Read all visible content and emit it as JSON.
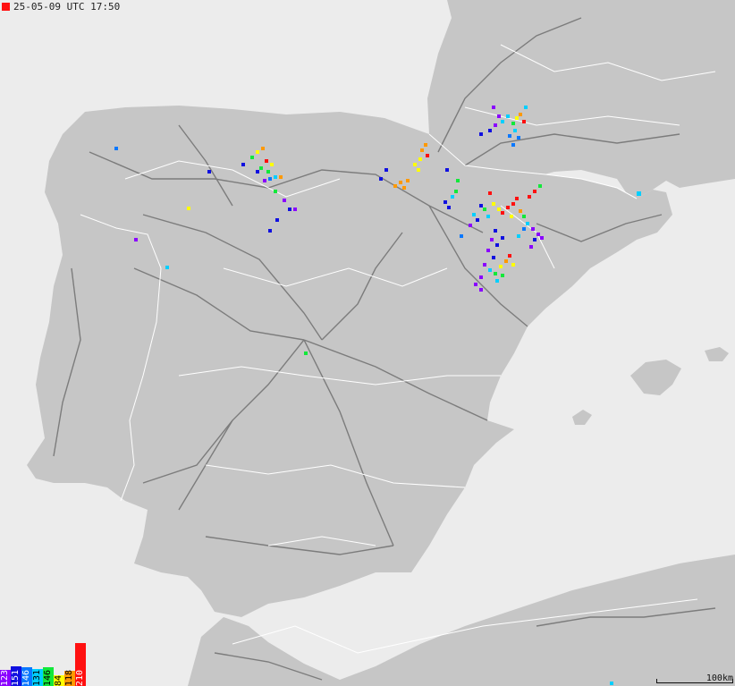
{
  "timestamp": {
    "text": "25-05-09 UTC 17:50",
    "marker_color": "#ff1010"
  },
  "scale": {
    "label": "100km"
  },
  "legend": [
    {
      "label": "123",
      "color": "#8a00ff",
      "level": 0.37
    },
    {
      "label": "151",
      "color": "#1010e0",
      "level": 0.45
    },
    {
      "label": "146",
      "color": "#0a78ff",
      "level": 0.44
    },
    {
      "label": "131",
      "color": "#00cfff",
      "level": 0.39
    },
    {
      "label": "146",
      "color": "#12e83a",
      "level": 0.44
    },
    {
      "label": "84",
      "color": "#ffff00",
      "level": 0.25
    },
    {
      "label": "118",
      "color": "#ff9900",
      "level": 0.35
    },
    {
      "label": "210",
      "color": "#ff1010",
      "level": 1.0
    }
  ],
  "colors": {
    "sea": "#ececec",
    "land": "#c6c6c6",
    "roads": "#7c7c7c",
    "borders": "#ffffff"
  }
}
